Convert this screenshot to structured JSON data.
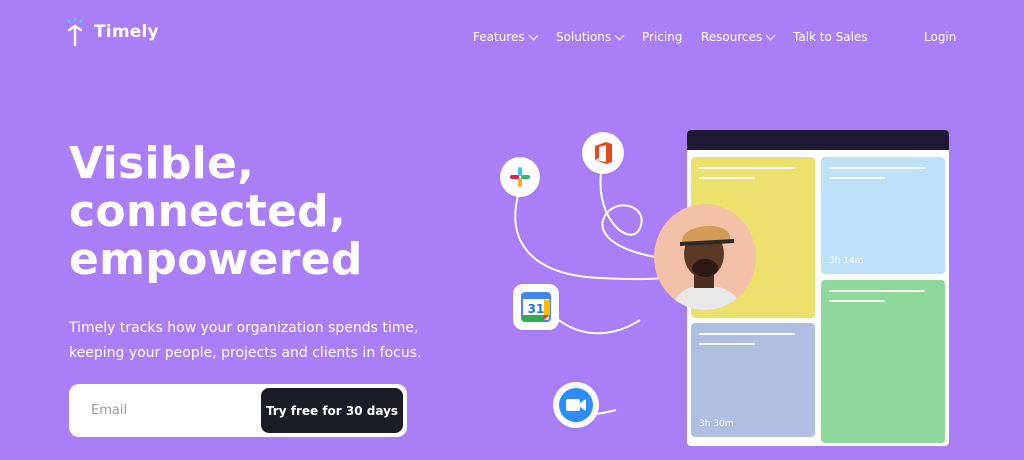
{
  "brand": {
    "name": "Timely"
  },
  "nav": {
    "items": [
      {
        "label": "Features",
        "dropdown": true
      },
      {
        "label": "Solutions",
        "dropdown": true
      },
      {
        "label": "Pricing",
        "dropdown": false
      },
      {
        "label": "Resources",
        "dropdown": true
      },
      {
        "label": "Talk to Sales",
        "dropdown": false
      }
    ],
    "login": "Login"
  },
  "hero": {
    "headline": [
      "Visible,",
      "connected,",
      "empowered"
    ],
    "subtitle": "Timely tracks how your organization spends time, keeping your people, projects and clients in focus.",
    "email_placeholder": "Email",
    "cta": "Try free for 30 days"
  },
  "illustration": {
    "cards": [
      {
        "color": "#ede16d",
        "time": ""
      },
      {
        "color": "#bfe0f9",
        "time": "3h 14m"
      },
      {
        "color": "#8fd89c",
        "time": ""
      },
      {
        "color": "#aebfe2",
        "time": "3h 30m"
      }
    ],
    "integrations": [
      "slack-icon",
      "office-icon",
      "google-calendar-icon",
      "zoom-icon"
    ],
    "calendar_day": "31"
  },
  "colors": {
    "background": "#a97ef6",
    "button": "#1c1b28",
    "board_header": "#1f1a33"
  }
}
